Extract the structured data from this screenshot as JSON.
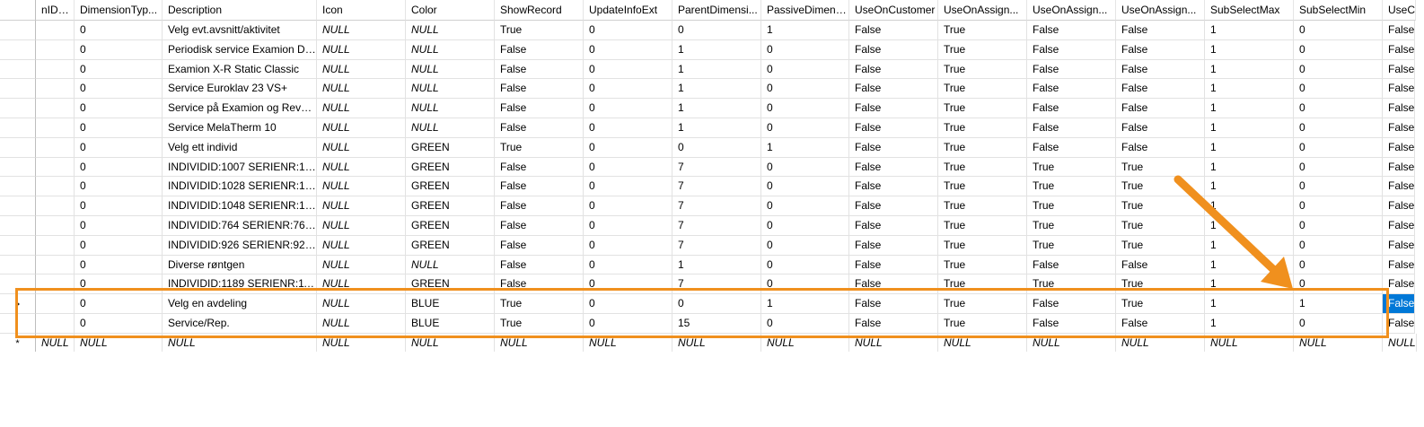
{
  "columns": [
    "nIDTe...",
    "DimensionTyp...",
    "Description",
    "Icon",
    "Color",
    "ShowRecord",
    "UpdateInfoExt",
    "ParentDimensi...",
    "PassiveDimens...",
    "UseOnCustomer",
    "UseOnAssign...",
    "UseOnAssign...",
    "UseOnAssign...",
    "SubSelectMax",
    "SubSelectMin",
    "UseC"
  ],
  "rows": [
    [
      "",
      "0",
      "Velg evt.avsnitt/aktivitet",
      "NULL",
      "NULL",
      "True",
      "0",
      "0",
      "1",
      "False",
      "True",
      "False",
      "False",
      "1",
      "0",
      "False"
    ],
    [
      "",
      "0",
      "Periodisk service Examion DR...",
      "NULL",
      "NULL",
      "False",
      "0",
      "1",
      "0",
      "False",
      "True",
      "False",
      "False",
      "1",
      "0",
      "False"
    ],
    [
      "",
      "0",
      "Examion X-R Static Classic",
      "NULL",
      "NULL",
      "False",
      "0",
      "1",
      "0",
      "False",
      "True",
      "False",
      "False",
      "1",
      "0",
      "False"
    ],
    [
      "",
      "0",
      "Service  Euroklav 23 VS+",
      "NULL",
      "NULL",
      "False",
      "0",
      "1",
      "0",
      "False",
      "True",
      "False",
      "False",
      "1",
      "0",
      "False"
    ],
    [
      "",
      "0",
      "Service på Examion og Revol...",
      "NULL",
      "NULL",
      "False",
      "0",
      "1",
      "0",
      "False",
      "True",
      "False",
      "False",
      "1",
      "0",
      "False"
    ],
    [
      "",
      "0",
      "Service MelaTherm 10",
      "NULL",
      "NULL",
      "False",
      "0",
      "1",
      "0",
      "False",
      "True",
      "False",
      "False",
      "1",
      "0",
      "False"
    ],
    [
      "",
      "0",
      "Velg ett individ",
      "NULL",
      "GREEN",
      "True",
      "0",
      "0",
      "1",
      "False",
      "True",
      "False",
      "False",
      "1",
      "0",
      "False"
    ],
    [
      "",
      "0",
      "INDIVIDID:1007 SERIENR:1007 ...",
      "NULL",
      "GREEN",
      "False",
      "0",
      "7",
      "0",
      "False",
      "True",
      "True",
      "True",
      "1",
      "0",
      "False"
    ],
    [
      "",
      "0",
      "INDIVIDID:1028 SERIENR:1028 ...",
      "NULL",
      "GREEN",
      "False",
      "0",
      "7",
      "0",
      "False",
      "True",
      "True",
      "True",
      "1",
      "0",
      "False"
    ],
    [
      "",
      "0",
      "INDIVIDID:1048 SERIENR:1048 ...",
      "NULL",
      "GREEN",
      "False",
      "0",
      "7",
      "0",
      "False",
      "True",
      "True",
      "True",
      "1",
      "0",
      "False"
    ],
    [
      "",
      "0",
      "INDIVIDID:764 SERIENR:764 RE...",
      "NULL",
      "GREEN",
      "False",
      "0",
      "7",
      "0",
      "False",
      "True",
      "True",
      "True",
      "1",
      "0",
      "False"
    ],
    [
      "",
      "0",
      "INDIVIDID:926 SERIENR:926 RE...",
      "NULL",
      "GREEN",
      "False",
      "0",
      "7",
      "0",
      "False",
      "True",
      "True",
      "True",
      "1",
      "0",
      "False"
    ],
    [
      "",
      "0",
      "Diverse røntgen",
      "NULL",
      "NULL",
      "False",
      "0",
      "1",
      "0",
      "False",
      "True",
      "False",
      "False",
      "1",
      "0",
      "False"
    ],
    [
      "",
      "0",
      "INDIVIDID:1189 SERIENR:1189 ...",
      "NULL",
      "GREEN",
      "False",
      "0",
      "7",
      "0",
      "False",
      "True",
      "True",
      "True",
      "1",
      "0",
      "False"
    ],
    [
      "",
      "0",
      "Velg en avdeling",
      "NULL",
      "BLUE",
      "True",
      "0",
      "0",
      "1",
      "False",
      "True",
      "False",
      "True",
      "1",
      "1",
      "False"
    ],
    [
      "",
      "0",
      "Service/Rep.",
      "NULL",
      "BLUE",
      "True",
      "0",
      "15",
      "0",
      "False",
      "True",
      "False",
      "False",
      "1",
      "0",
      "False"
    ],
    [
      "NULL",
      "NULL",
      "NULL",
      "NULL",
      "NULL",
      "NULL",
      "NULL",
      "NULL",
      "NULL",
      "NULL",
      "NULL",
      "NULL",
      "NULL",
      "NULL",
      "NULL",
      "NULL"
    ]
  ],
  "gutter": {
    "current_row_marker": "▶",
    "new_row_marker": "*"
  },
  "selected": {
    "row": 14,
    "col": 15
  },
  "colors": {
    "highlight_box": "#f0901e",
    "selection": "#0078d7",
    "grid_line": "#e2e2e2"
  }
}
